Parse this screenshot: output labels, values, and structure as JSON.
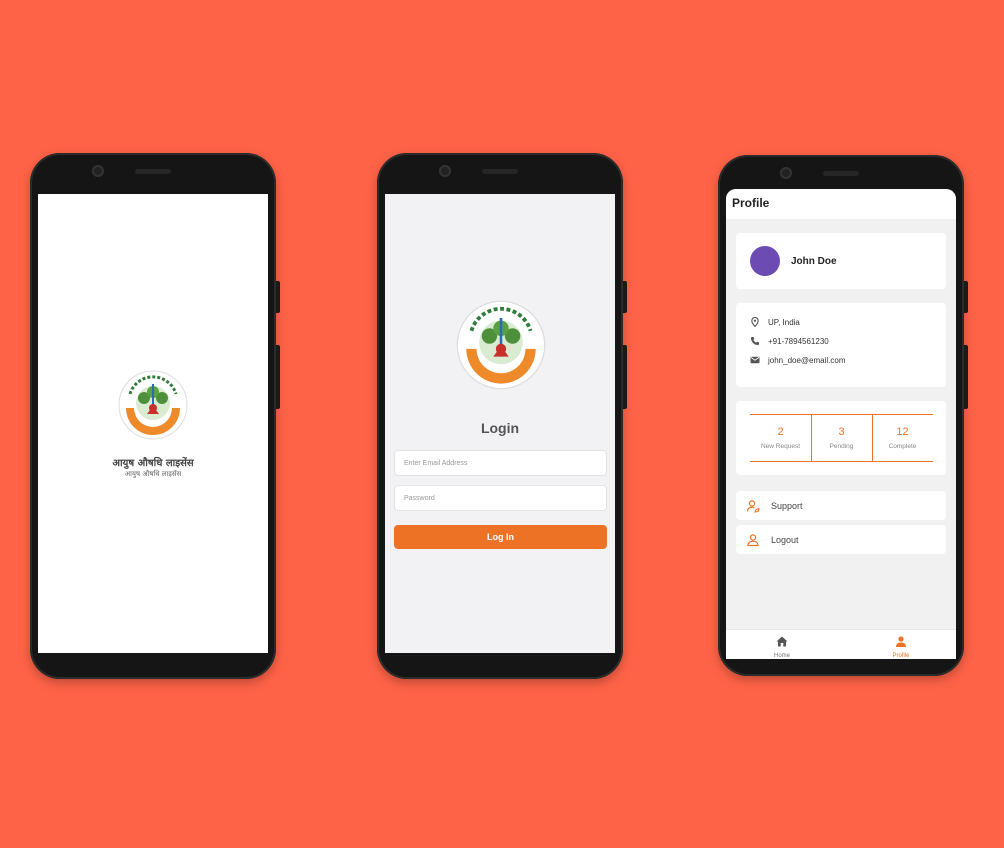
{
  "splash": {
    "title": "आयुष औषधि लाइसेंस",
    "subtitle": "आयुष औषधि लाइसेंस",
    "logo_icon": "ayush-emblem-icon"
  },
  "login": {
    "title": "Login",
    "email_placeholder": "Enter Email Address",
    "password_placeholder": "Password",
    "button_label": "Log In",
    "logo_icon": "ayush-emblem-icon"
  },
  "profile": {
    "header_title": "Profile",
    "user_name": "John Doe",
    "location": "UP, India",
    "phone": "+91-7894561230",
    "email": "john_doe@email.com",
    "stats": [
      {
        "value": "2",
        "label": "New Request"
      },
      {
        "value": "3",
        "label": "Pending"
      },
      {
        "value": "12",
        "label": "Complete"
      }
    ],
    "menu": [
      {
        "label": "Support",
        "icon": "support-icon"
      },
      {
        "label": "Logout",
        "icon": "logout-icon"
      }
    ],
    "nav": [
      {
        "label": "Home",
        "icon": "home-icon"
      },
      {
        "label": "Profile",
        "icon": "person-icon"
      }
    ]
  },
  "colors": {
    "background": "#FF6347",
    "accent": "#EE7226",
    "avatar": "#6C4BB3"
  }
}
